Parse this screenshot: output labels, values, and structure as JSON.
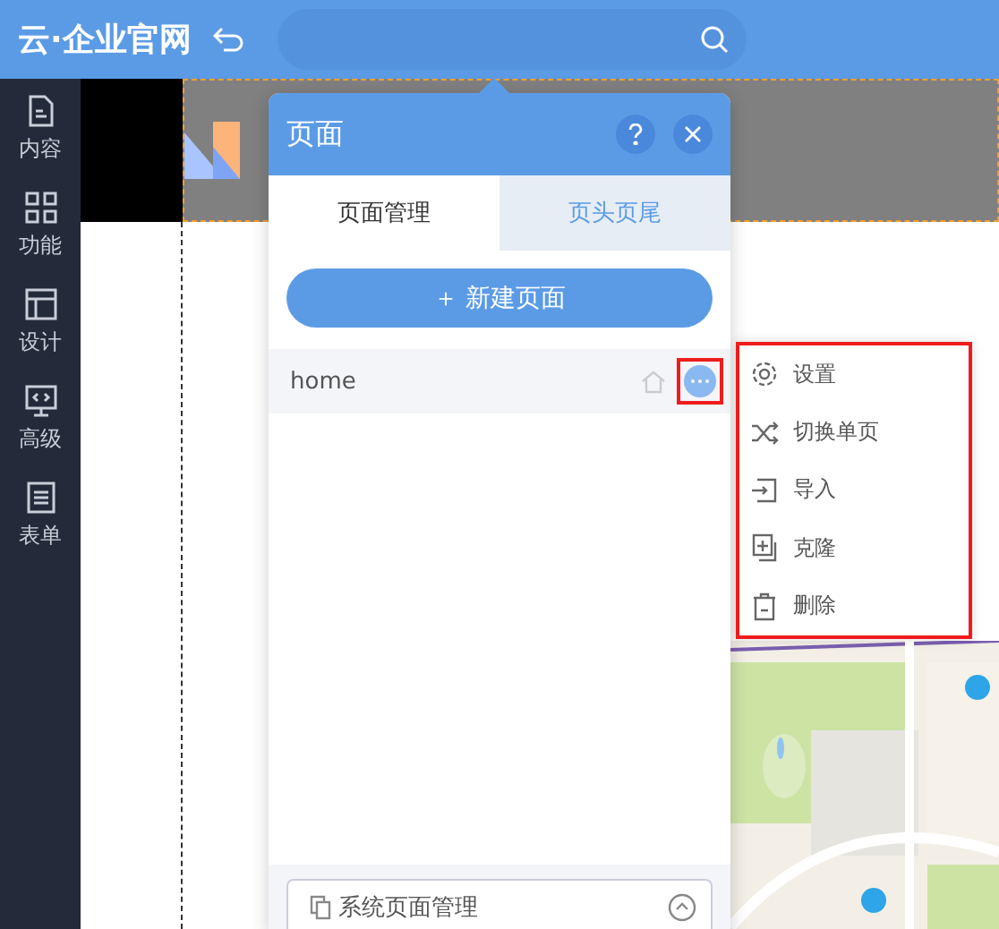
{
  "topbar": {
    "logo": "云·企业官网"
  },
  "sidebar": {
    "items": [
      {
        "label": "内容",
        "kind": "file"
      },
      {
        "label": "功能",
        "kind": "grid"
      },
      {
        "label": "设计",
        "kind": "layout"
      },
      {
        "label": "高级",
        "kind": "code"
      },
      {
        "label": "表单",
        "kind": "list"
      }
    ]
  },
  "panel": {
    "title": "页面",
    "tabs": [
      {
        "label": "页面管理",
        "selected": true
      },
      {
        "label": "页头页尾",
        "selected": false
      }
    ],
    "new_button": {
      "icon": "＋",
      "label": "新建页面"
    },
    "pages": [
      {
        "name": "home",
        "home": true,
        "selected": true
      }
    ],
    "footer": {
      "label": "系统页面管理",
      "expanded": false
    }
  },
  "menu": {
    "items": [
      {
        "label": "设置",
        "kind": "gear"
      },
      {
        "label": "切换单页",
        "kind": "shuffle"
      },
      {
        "label": "导入",
        "kind": "import"
      },
      {
        "label": "克隆",
        "kind": "clone"
      },
      {
        "label": "删除",
        "kind": "trash"
      }
    ]
  }
}
